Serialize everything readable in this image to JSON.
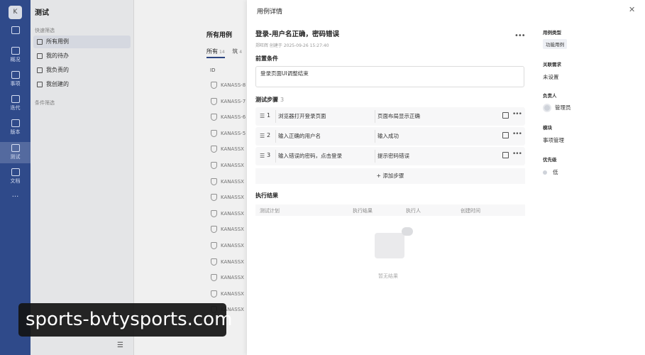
{
  "rail": {
    "avatar_letter": "K",
    "items": [
      {
        "label": "",
        "icon": "home-icon"
      },
      {
        "label": "概况",
        "icon": "overview-icon"
      },
      {
        "label": "事项",
        "icon": "tasks-icon"
      },
      {
        "label": "迭代",
        "icon": "iteration-icon"
      },
      {
        "label": "版本",
        "icon": "version-icon"
      },
      {
        "label": "测试",
        "icon": "test-icon"
      },
      {
        "label": "文档",
        "icon": "doc-icon"
      },
      {
        "label": "···",
        "icon": "more-icon"
      }
    ]
  },
  "sidebar": {
    "title": "测试",
    "quick_group": "快速筛选",
    "items": [
      {
        "label": "所有用例"
      },
      {
        "label": "我的待办"
      },
      {
        "label": "我负责的"
      },
      {
        "label": "我创建的"
      }
    ],
    "filter_group": "条件筛选"
  },
  "list": {
    "title": "所有用例",
    "tabs": [
      {
        "label": "所有",
        "count": "14"
      },
      {
        "label": "筑",
        "count": "4"
      }
    ],
    "column_id": "ID",
    "rows": [
      "KANASS-8",
      "KANASS-7",
      "KANASS-6",
      "KANASS-5",
      "KANASSX",
      "KANASSX",
      "KANASSX",
      "KANASSX",
      "KANASSX",
      "KANASSX",
      "KANASSX",
      "KANASSX",
      "KANASSX",
      "KANASSX",
      "KANASSX"
    ]
  },
  "panel": {
    "title": "用例详情",
    "case_title": "登录-用户名正确，密码错误",
    "meta": "郑旺辉 创建于 2025-09-26 15:27:40",
    "precondition_label": "前置条件",
    "precondition_value": "登录页面UI调整结束",
    "steps_label": "测试步骤",
    "steps_count": "3",
    "steps": [
      {
        "num": "1",
        "desc": "浏览器打开登录页面",
        "expect": "页面布局显示正确"
      },
      {
        "num": "2",
        "desc": "输入正确的用户名",
        "expect": "输入成功"
      },
      {
        "num": "3",
        "desc": "输入错误的密码，点击登录",
        "expect": "提示密码错误"
      }
    ],
    "add_step": "添加步骤",
    "results_label": "执行结果",
    "results_columns": [
      "测试计划",
      "执行结果",
      "执行人",
      "创建时间"
    ],
    "empty_text": "暂无结果",
    "fields": {
      "type_label": "用例类型",
      "type_value": "功能用例",
      "demand_label": "关联需求",
      "demand_value": "未设置",
      "owner_label": "负责人",
      "owner_value": "管理员",
      "module_label": "模块",
      "module_value": "事项管理",
      "priority_label": "优先级",
      "priority_value": "低"
    }
  },
  "banner": {
    "text": "sports-bvtysports.com"
  }
}
